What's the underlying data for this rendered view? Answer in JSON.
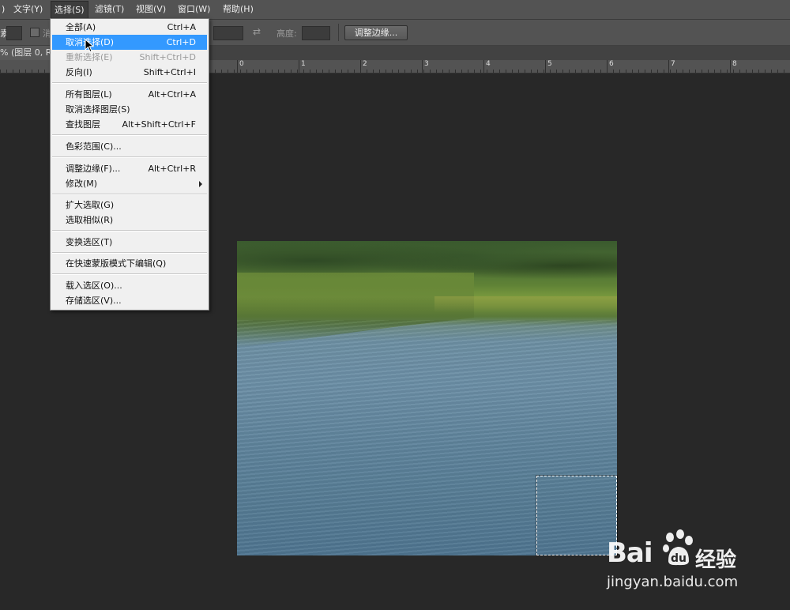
{
  "menubar": {
    "items": [
      {
        "label": ")"
      },
      {
        "label": "文字(Y)"
      },
      {
        "label": "选择(S)"
      },
      {
        "label": "滤镜(T)"
      },
      {
        "label": "视图(V)"
      },
      {
        "label": "窗口(W)"
      },
      {
        "label": "帮助(H)"
      }
    ]
  },
  "optbar": {
    "left_text": "素",
    "anti_alias_char": "消",
    "height_label": "高度:",
    "refine_button": "调整边缘..."
  },
  "doc_tab": {
    "label": "% (图层 0, R"
  },
  "ruler": {
    "labels": [
      "0",
      "1",
      "2",
      "3",
      "4",
      "5",
      "6",
      "7",
      "8"
    ]
  },
  "select_menu": {
    "items": [
      {
        "label": "全部(A)",
        "shortcut": "Ctrl+A"
      },
      {
        "label": "取消选择(D)",
        "shortcut": "Ctrl+D"
      },
      {
        "label": "重新选择(E)",
        "shortcut": "Shift+Ctrl+D"
      },
      {
        "label": "反向(I)",
        "shortcut": "Shift+Ctrl+I"
      },
      {
        "label": "所有图层(L)",
        "shortcut": "Alt+Ctrl+A"
      },
      {
        "label": "取消选择图层(S)",
        "shortcut": ""
      },
      {
        "label": "查找图层",
        "shortcut": "Alt+Shift+Ctrl+F"
      },
      {
        "label": "色彩范围(C)...",
        "shortcut": ""
      },
      {
        "label": "调整边缘(F)...",
        "shortcut": "Alt+Ctrl+R"
      },
      {
        "label": "修改(M)",
        "shortcut": ""
      },
      {
        "label": "扩大选取(G)",
        "shortcut": ""
      },
      {
        "label": "选取相似(R)",
        "shortcut": ""
      },
      {
        "label": "变换选区(T)",
        "shortcut": ""
      },
      {
        "label": "在快速蒙版模式下编辑(Q)",
        "shortcut": ""
      },
      {
        "label": "载入选区(O)...",
        "shortcut": ""
      },
      {
        "label": "存储选区(V)...",
        "shortcut": ""
      }
    ]
  },
  "watermark": {
    "brand_left": "Bai",
    "brand_right": "经验",
    "url": "jingyan.baidu.com"
  },
  "colors": {
    "menu_highlight": "#3399ff",
    "ui_dark": "#282828",
    "ui_panel": "#535353"
  }
}
